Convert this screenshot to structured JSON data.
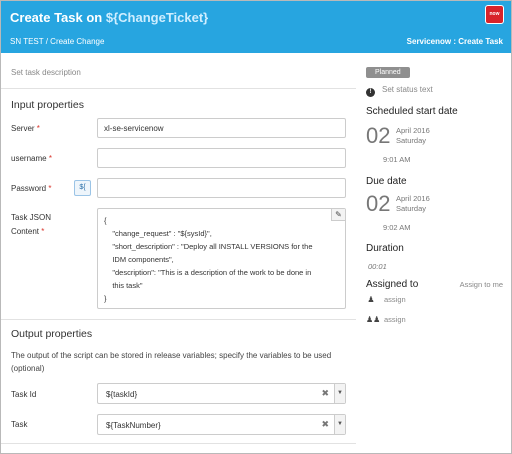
{
  "header": {
    "title_prefix": "Create Task on ",
    "title_var": "${ChangeTicket}",
    "breadcrumb": "SN TEST / Create Change",
    "right_label": "Servicenow : Create Task",
    "logo_text": "now"
  },
  "left": {
    "description_placeholder": "Set task description",
    "input_section_title": "Input properties",
    "fields": {
      "server": {
        "label": "Server",
        "required": "*",
        "value": "xl-se-servicenow"
      },
      "username": {
        "label": "username",
        "required": "*",
        "value": ""
      },
      "password": {
        "label": "Password",
        "required": "*",
        "var_button": "${",
        "value": ""
      },
      "task_json": {
        "label_line1": "Task JSON",
        "label_line2": "Content",
        "required": "*",
        "lines": [
          "{",
          "    \"change_request\" : \"${sysId}\",",
          "    \"short_description\" : \"Deploy all INSTALL VERSIONS for the",
          "    IDM components\",",
          "    \"description\": \"This is a description of the work to be done in",
          "    this task\"",
          "}"
        ]
      }
    },
    "output_section_title": "Output properties",
    "output_description": "The output of the script can be stored in release variables; specify the variables to be used (optional)",
    "outputs": {
      "task_id": {
        "label": "Task Id",
        "value": "${taskId}",
        "clear": "✖",
        "caret": "▼"
      },
      "task": {
        "label": "Task",
        "value": "${TaskNumber}",
        "clear": "✖",
        "caret": "▼"
      }
    }
  },
  "right": {
    "status_badge": "Planned",
    "status_text": "Set status text",
    "scheduled_start": {
      "title": "Scheduled start date",
      "day": "02",
      "month_year": "April 2016",
      "weekday": "Saturday",
      "time": "9:01 AM"
    },
    "due_date": {
      "title": "Due date",
      "day": "02",
      "month_year": "April 2016",
      "weekday": "Saturday",
      "time": "9:02 AM"
    },
    "duration": {
      "title": "Duration",
      "value": "00:01"
    },
    "assigned": {
      "title": "Assigned to",
      "assign_to_me": "Assign to me",
      "user_assign": "assign",
      "team_assign": "assign"
    }
  }
}
